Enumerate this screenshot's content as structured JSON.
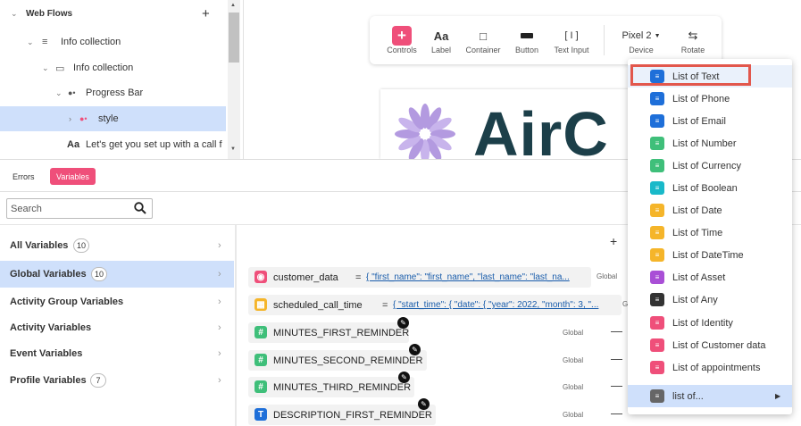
{
  "tree": {
    "rows": [
      {
        "label": "Web Flows",
        "action": "+"
      },
      {
        "label": "Info collection"
      },
      {
        "label": "Info collection"
      },
      {
        "label": "Progress Bar"
      },
      {
        "label": "style"
      },
      {
        "label": "Let's get you set up with a call f"
      }
    ]
  },
  "toolbar": {
    "controls": "Controls",
    "label": "Label",
    "container": "Container",
    "button": "Button",
    "text_input": "Text Input",
    "device_value": "Pixel 2",
    "device_label": "Device",
    "rotate": "Rotate"
  },
  "preview": {
    "logo_text": "AirC"
  },
  "tabs": {
    "errors": "Errors",
    "variables": "Variables"
  },
  "search": {
    "placeholder": "Search"
  },
  "categories": [
    {
      "label": "All Variables",
      "count": "10"
    },
    {
      "label": "Global Variables",
      "count": "10"
    },
    {
      "label": "Activity Group Variables",
      "count": ""
    },
    {
      "label": "Activity Variables",
      "count": ""
    },
    {
      "label": "Event Variables",
      "count": ""
    },
    {
      "label": "Profile Variables",
      "count": "7"
    }
  ],
  "add_label": "+",
  "variables": [
    {
      "name": "customer_data",
      "eq": "=",
      "value": "{ \"first_name\": \"first_name\", \"last_name\": \"last_na...",
      "scope": "Global",
      "color": "#ef4f7a",
      "icon": "customer-data-icon"
    },
    {
      "name": "scheduled_call_time",
      "eq": "=",
      "value": "{ \"start_time\": { \"date\": { \"year\": 2022, \"month\": 3, \"...",
      "scope": "Gl",
      "color": "#f5b52a",
      "icon": "datetime-icon"
    },
    {
      "name": "MINUTES_FIRST_REMINDER",
      "scope": "Global",
      "minus": "—",
      "color": "#3fbf7a",
      "icon": "number-icon",
      "glyph": "#"
    },
    {
      "name": "MINUTES_SECOND_REMINDER",
      "scope": "Global",
      "minus": "—",
      "color": "#3fbf7a",
      "icon": "number-icon",
      "glyph": "#"
    },
    {
      "name": "MINUTES_THIRD_REMINDER",
      "scope": "Global",
      "minus": "—",
      "color": "#3fbf7a",
      "icon": "number-icon",
      "glyph": "#"
    },
    {
      "name": "DESCRIPTION_FIRST_REMINDER",
      "scope": "Global",
      "minus": "—",
      "color": "#1e6fd9",
      "icon": "text-icon",
      "glyph": "T"
    }
  ],
  "menu": {
    "items": [
      {
        "label": "List of Text",
        "color": "#1e6fd9",
        "icon": "list-text-icon"
      },
      {
        "label": "List of Phone",
        "color": "#1e6fd9",
        "icon": "list-phone-icon"
      },
      {
        "label": "List of Email",
        "color": "#1e6fd9",
        "icon": "list-email-icon"
      },
      {
        "label": "List of Number",
        "color": "#3fbf7a",
        "icon": "list-number-icon"
      },
      {
        "label": "List of Currency",
        "color": "#3fbf7a",
        "icon": "list-currency-icon"
      },
      {
        "label": "List of Boolean",
        "color": "#19b9c9",
        "icon": "list-boolean-icon"
      },
      {
        "label": "List of Date",
        "color": "#f5b52a",
        "icon": "list-date-icon"
      },
      {
        "label": "List of Time",
        "color": "#f5b52a",
        "icon": "list-time-icon"
      },
      {
        "label": "List of DateTime",
        "color": "#f5b52a",
        "icon": "list-datetime-icon"
      },
      {
        "label": "List of Asset",
        "color": "#a94fd6",
        "icon": "list-asset-icon"
      },
      {
        "label": "List of Any",
        "color": "#333333",
        "icon": "list-any-icon"
      },
      {
        "label": "List of Identity",
        "color": "#ef4f7a",
        "icon": "list-identity-icon"
      },
      {
        "label": "List of Customer data",
        "color": "#ef4f7a",
        "icon": "list-customer-data-icon"
      },
      {
        "label": "List of appointments",
        "color": "#ef4f7a",
        "icon": "list-appointments-icon"
      }
    ],
    "bottom": {
      "label": "list of...",
      "color": "#666666",
      "icon": "list-of-icon"
    }
  }
}
